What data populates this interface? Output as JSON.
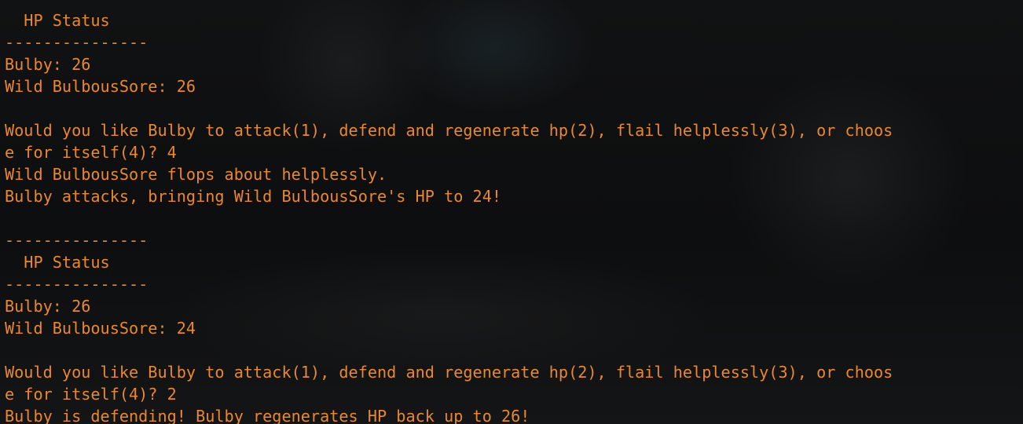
{
  "terminal": {
    "lines": [
      "---------------",
      "  HP Status",
      "---------------",
      "Bulby: 26",
      "Wild BulbousSore: 26",
      "",
      "Would you like Bulby to attack(1), defend and regenerate hp(2), flail helplessly(3), or choos",
      "e for itself(4)? 4",
      "Wild BulbousSore flops about helplessly.",
      "Bulby attacks, bringing Wild BulbousSore's HP to 24!",
      "",
      "---------------",
      "  HP Status",
      "---------------",
      "Bulby: 26",
      "Wild BulbousSore: 24",
      "",
      "Would you like Bulby to attack(1), defend and regenerate hp(2), flail helplessly(3), or choos",
      "e for itself(4)? 2",
      "Bulby is defending! Bulby regenerates HP back up to 26!"
    ],
    "text_color": "#e9882c",
    "background_color": "#0b0c0d"
  }
}
